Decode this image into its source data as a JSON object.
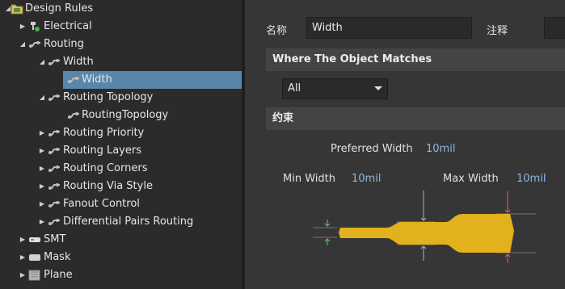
{
  "tree": {
    "items": [
      {
        "label": "Design Rules",
        "arrow": "▲",
        "icon": "folder-rules-icon"
      },
      {
        "label": "Electrical",
        "arrow": "▶",
        "icon": "electrical-icon"
      },
      {
        "label": "Routing",
        "arrow": "▲",
        "icon": "routing-icon"
      },
      {
        "label": "Width",
        "arrow": "▲",
        "icon": "width-rule-icon"
      },
      {
        "label": "Width",
        "arrow": "",
        "icon": "width-rule-icon"
      },
      {
        "label": "Routing Topology",
        "arrow": "▲",
        "icon": "routing-icon"
      },
      {
        "label": "RoutingTopology",
        "arrow": "",
        "icon": "routing-icon"
      },
      {
        "label": "Routing Priority",
        "arrow": "▶",
        "icon": "routing-icon"
      },
      {
        "label": "Routing Layers",
        "arrow": "▶",
        "icon": "routing-icon"
      },
      {
        "label": "Routing Corners",
        "arrow": "▶",
        "icon": "routing-icon"
      },
      {
        "label": "Routing Via Style",
        "arrow": "▶",
        "icon": "routing-icon"
      },
      {
        "label": "Fanout Control",
        "arrow": "▶",
        "icon": "routing-icon"
      },
      {
        "label": "Differential Pairs Routing",
        "arrow": "▶",
        "icon": "routing-icon"
      },
      {
        "label": "SMT",
        "arrow": "▶",
        "icon": "smt-icon"
      },
      {
        "label": "Mask",
        "arrow": "▶",
        "icon": "mask-icon"
      },
      {
        "label": "Plane",
        "arrow": "▶",
        "icon": "plane-icon"
      }
    ],
    "selected_index": 4
  },
  "form": {
    "name_label": "名称",
    "name_value": "Width",
    "comment_label": "注释"
  },
  "where_section": {
    "title": "Where The Object Matches",
    "scope_value": "All"
  },
  "constraints": {
    "title": "约束",
    "preferred_label": "Preferred Width",
    "preferred_value": "10mil",
    "min_label": "Min Width",
    "min_value": "10mil",
    "max_label": "Max Width",
    "max_value": "10mil"
  },
  "colors": {
    "selection": "#5a86a9",
    "track": "#e3b01e",
    "value_text": "#8fb6e6"
  }
}
